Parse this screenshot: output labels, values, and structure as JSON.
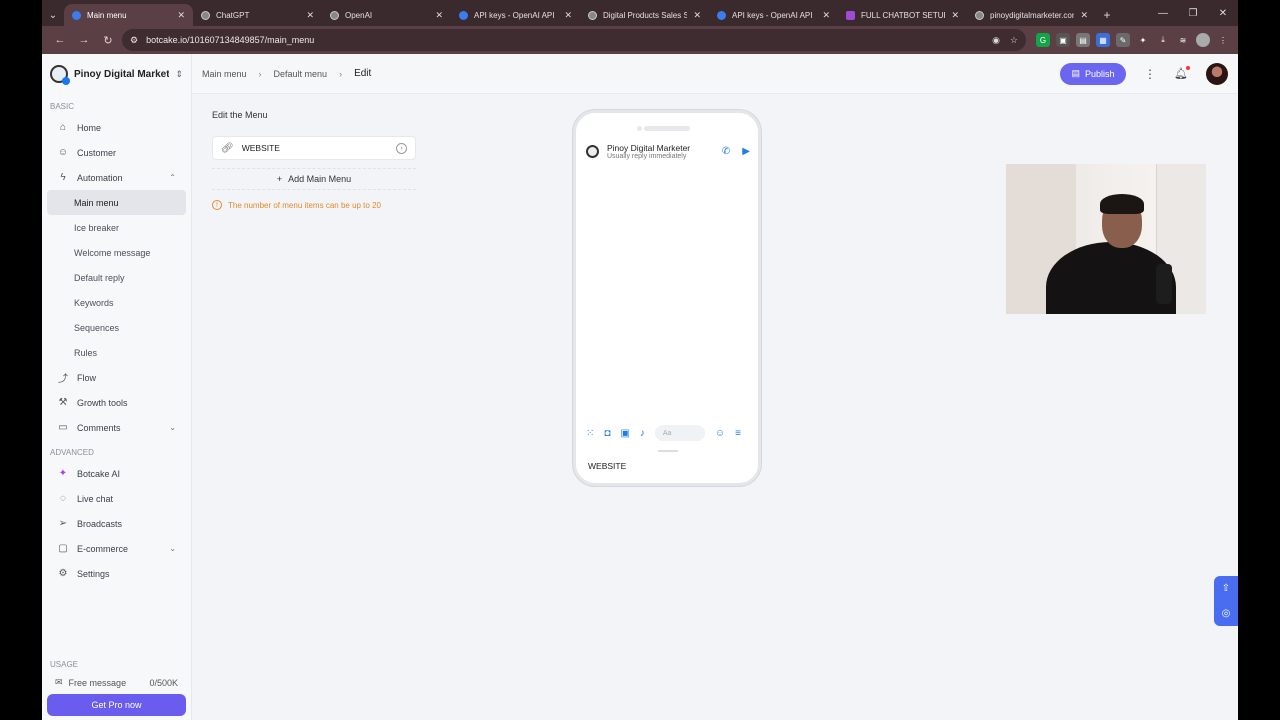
{
  "browser": {
    "tabs": [
      {
        "title": "Main menu",
        "active": true
      },
      {
        "title": "ChatGPT",
        "active": false
      },
      {
        "title": "OpenAI",
        "active": false
      },
      {
        "title": "API keys - OpenAI API",
        "active": false
      },
      {
        "title": "Digital Products Sales Se",
        "active": false
      },
      {
        "title": "API keys - OpenAI API",
        "active": false
      },
      {
        "title": "FULL CHATBOT SETUP CU",
        "active": false
      },
      {
        "title": "pinoydigitalmarketer.con",
        "active": false
      }
    ],
    "url": "botcake.io/101607134849857/main_menu"
  },
  "sidebar": {
    "brand": "Pinoy Digital Market...",
    "section_basic": "BASIC",
    "home": "Home",
    "customer": "Customer",
    "automation": "Automation",
    "sub_items": [
      "Main menu",
      "Ice breaker",
      "Welcome message",
      "Default reply",
      "Keywords",
      "Sequences",
      "Rules"
    ],
    "flow": "Flow",
    "growth": "Growth tools",
    "comments": "Comments",
    "section_advanced": "ADVANCED",
    "botcake_ai": "Botcake AI",
    "live_chat": "Live chat",
    "broadcasts": "Broadcasts",
    "ecommerce": "E-commerce",
    "settings": "Settings",
    "section_usage": "USAGE",
    "usage_label": "Free message",
    "usage_value": "0/500K",
    "pro_button": "Get Pro now"
  },
  "header": {
    "crumbs": [
      "Main menu",
      "Default menu",
      "Edit"
    ],
    "publish": "Publish"
  },
  "editor": {
    "title": "Edit the Menu",
    "item": "WEBSITE",
    "add_label": "Add Main Menu",
    "warning": "The number of menu items can be up to 20"
  },
  "preview": {
    "page_name": "Pinoy Digital Marketer",
    "status": "Usually reply immediately",
    "input_placeholder": "Aa",
    "menu_item": "WEBSITE"
  },
  "colors": {
    "accent": "#6b66f0",
    "warning": "#e4892d",
    "messenger_blue": "#1d7ee8"
  }
}
